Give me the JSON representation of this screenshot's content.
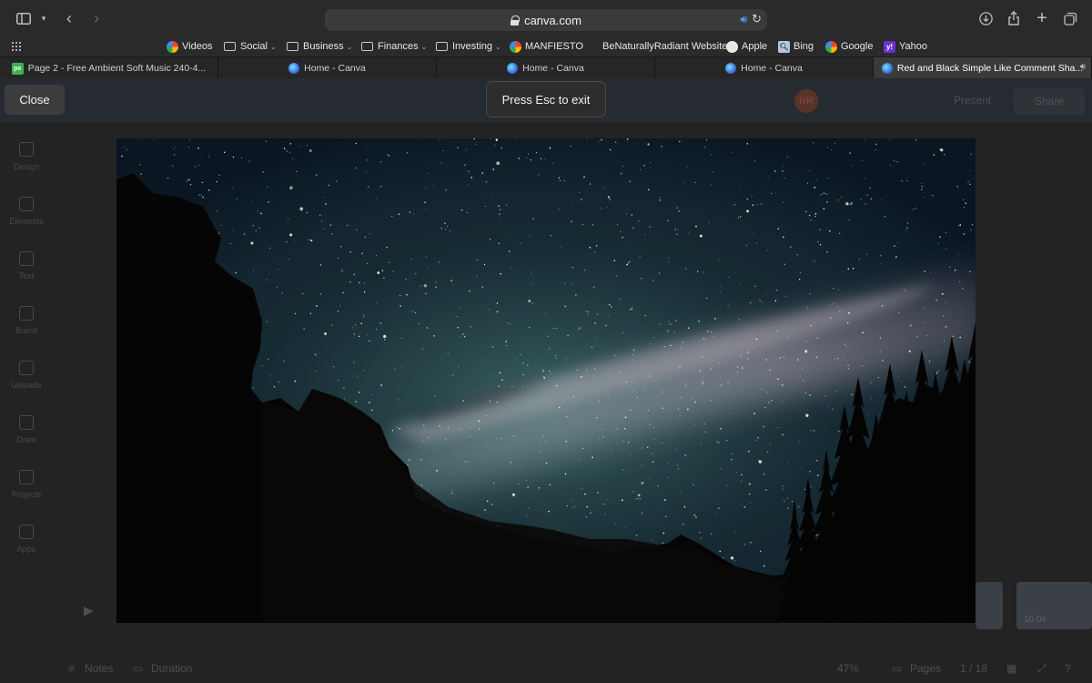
{
  "browser": {
    "url": "canva.com"
  },
  "bookmarks": [
    {
      "label": "Videos",
      "icon": "google-icon"
    },
    {
      "label": "Social",
      "icon": "folder-icon",
      "has_menu": true
    },
    {
      "label": "Business",
      "icon": "folder-icon",
      "has_menu": true
    },
    {
      "label": "Finances",
      "icon": "folder-icon",
      "has_menu": true
    },
    {
      "label": "Investing",
      "icon": "folder-icon",
      "has_menu": true
    },
    {
      "label": "MANFIESTO",
      "icon": "google-icon"
    },
    {
      "label": "BeNaturallyRadiant Website",
      "icon": "none"
    },
    {
      "label": "Apple",
      "icon": "apple-icon"
    },
    {
      "label": "Bing",
      "icon": "bing-icon"
    },
    {
      "label": "Google",
      "icon": "google-icon"
    },
    {
      "label": "Yahoo",
      "icon": "yahoo-icon"
    }
  ],
  "tabs": [
    {
      "label": "Page 2 - Free Ambient Soft Music 240-4...",
      "icon": "pixabay-icon",
      "active": false
    },
    {
      "label": "Home - Canva",
      "icon": "canva-icon",
      "active": false
    },
    {
      "label": "Home - Canva",
      "icon": "canva-icon",
      "active": false
    },
    {
      "label": "Home - Canva",
      "icon": "canva-icon",
      "active": false
    },
    {
      "label": "Red and Black Simple Like Comment Sha...",
      "icon": "canva-icon",
      "active": true,
      "audio": true
    }
  ],
  "presentation": {
    "close_label": "Close",
    "esc_hint": "Press Esc to exit"
  },
  "editor_dimmed": {
    "sidebar": [
      "Design",
      "Elements",
      "Text",
      "Brand",
      "Uploads",
      "Draw",
      "Projects",
      "Apps"
    ],
    "avatar_initials": "NR",
    "share_label": "Share",
    "present_label": "Present",
    "notes_label": "Notes",
    "duration_label": "Duration",
    "zoom": "47%",
    "pages_label": "Pages",
    "page_count": "1 / 18",
    "timeline_thumb_label": "10.0s"
  },
  "colors": {
    "sky_top": "#0a1622",
    "sky_glow": "#3f6a6a",
    "milky_way": "#b9a9b8",
    "silhouette": "#050505",
    "accent_audio": "#5aa0ff"
  }
}
